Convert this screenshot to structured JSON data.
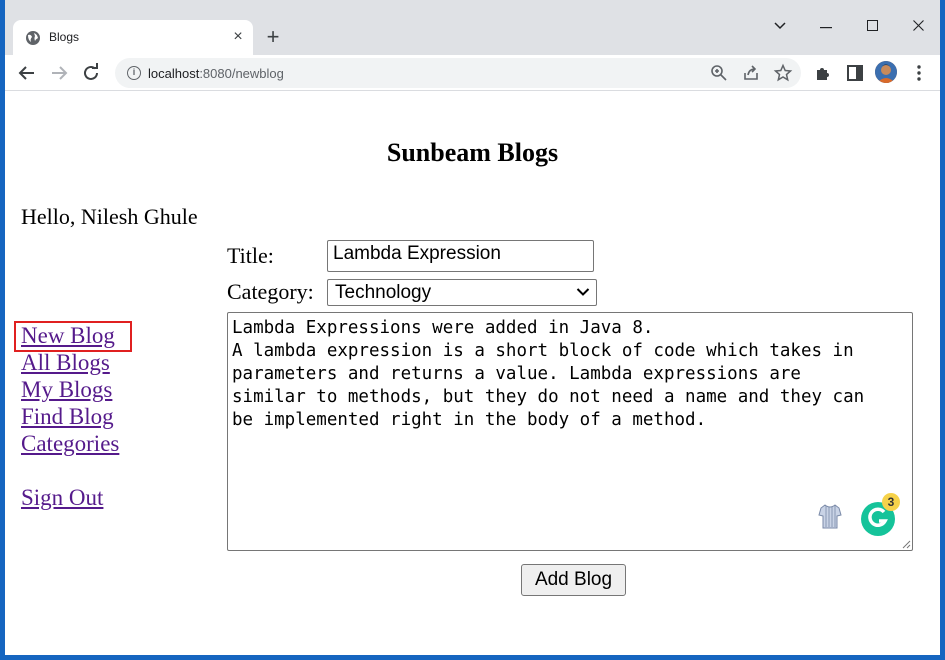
{
  "browser": {
    "tab_title": "Blogs",
    "tab_close": "×",
    "new_tab": "+",
    "url_host": "localhost",
    "url_path": ":8080/newblog",
    "window_controls": {
      "minimize": "—",
      "maximize": "☐",
      "close": "✕",
      "tab_search": "⌄"
    }
  },
  "page": {
    "title": "Sunbeam Blogs",
    "greeting": "Hello, Nilesh Ghule",
    "nav": {
      "new_blog": "New Blog",
      "all_blogs": "All Blogs",
      "my_blogs": "My Blogs",
      "find_blog": "Find Blog",
      "categories": "Categories",
      "sign_out": "Sign Out"
    },
    "form": {
      "title_label": "Title:",
      "title_value": "Lambda Expression",
      "category_label": "Category:",
      "category_value": "Technology",
      "contents": "Lambda Expressions were added in Java 8.\nA lambda expression is a short block of code which takes in\nparameters and returns a value. Lambda expressions are\nsimilar to methods, but they do not need a name and they can\nbe implemented right in the body of a method.",
      "add_button": "Add Blog"
    },
    "grammarly_badge": "3"
  },
  "colors": {
    "link": "#551a8b",
    "highlight": "#e02020",
    "grammarly": "#15c39a",
    "desktop": "#1565c0"
  },
  "icons": [
    "globe-icon",
    "back-arrow-icon",
    "forward-arrow-icon",
    "reload-icon",
    "site-info-icon",
    "zoom-icon",
    "share-icon",
    "bookmark-star-icon",
    "extensions-icon",
    "side-panel-icon",
    "avatar",
    "menu-kebab-icon",
    "grammarly-icon",
    "shirt-icon"
  ]
}
